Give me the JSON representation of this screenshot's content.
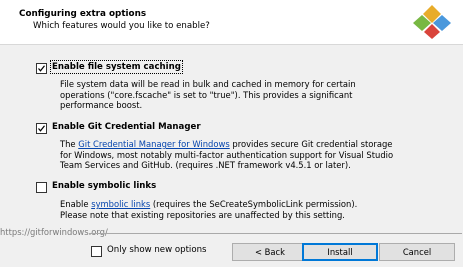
{
  "header": {
    "title": "Configuring extra options",
    "subtitle": "Which features would you like to enable?",
    "logo_icon": "git-logo-icon"
  },
  "options": [
    {
      "label": "Enable file system caching",
      "checked": true,
      "description": [
        "File system data will be read in bulk and cached in memory for certain",
        "operations (\"core.fscache\" is set to \"true\"). This provides a significant",
        "performance boost."
      ]
    },
    {
      "label": "Enable Git Credential Manager",
      "checked": true,
      "description_line1_prefix": "The ",
      "description_line1_link": "Git Credential Manager for Windows",
      "description_line1_suffix": " provides secure Git credential storage",
      "description": [
        "for Windows, most notably multi-factor authentication support for Visual Studio",
        "Team Services and GitHub. (requires .NET framework v4.5.1 or later)."
      ]
    },
    {
      "label": "Enable symbolic links",
      "checked": false,
      "description_line1_prefix": "Enable ",
      "description_line1_link": "symbolic links",
      "description_line1_suffix": " (requires the SeCreateSymbolicLink permission).",
      "description": [
        "Please note that existing repositories are unaffected by this setting."
      ]
    }
  ],
  "footer": {
    "url": "https://gitforwindows.org/",
    "only_new_options_label": "Only show new options",
    "only_new_options_checked": false,
    "back_button": "< Back",
    "install_button": "Install",
    "cancel_button": "Cancel"
  },
  "colors": {
    "link": "#0645ad",
    "primary_button_border": "#0078d7"
  }
}
